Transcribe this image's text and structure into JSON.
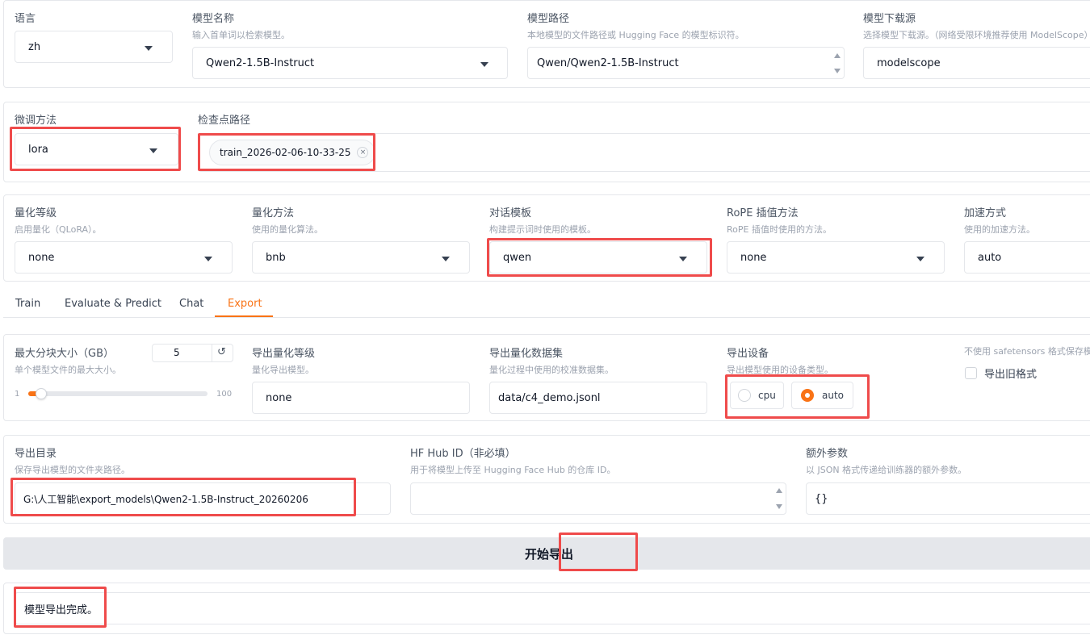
{
  "row1": {
    "language": {
      "label": "语言",
      "value": "zh"
    },
    "model_name": {
      "label": "模型名称",
      "hint": "输入首单词以检索模型。",
      "value": "Qwen2-1.5B-Instruct"
    },
    "model_path": {
      "label": "模型路径",
      "hint": "本地模型的文件路径或 Hugging Face 的模型标识符。",
      "value": "Qwen/Qwen2-1.5B-Instruct"
    },
    "download_source": {
      "label": "模型下载源",
      "hint": "选择模型下载源。（网络受限环境推荐使用 ModelScope）",
      "value": "modelscope"
    }
  },
  "row2": {
    "finetune": {
      "label": "微调方法",
      "value": "lora"
    },
    "checkpoint": {
      "label": "检查点路径",
      "tag": "train_2026-02-06-10-33-25"
    }
  },
  "row3": {
    "quant_bit": {
      "label": "量化等级",
      "hint": "启用量化（QLoRA）。",
      "value": "none"
    },
    "quant_method": {
      "label": "量化方法",
      "hint": "使用的量化算法。",
      "value": "bnb"
    },
    "template": {
      "label": "对话模板",
      "hint": "构建提示词时使用的模板。",
      "value": "qwen"
    },
    "rope": {
      "label": "RoPE 插值方法",
      "hint": "RoPE 插值时使用的方法。",
      "value": "none"
    },
    "booster": {
      "label": "加速方式",
      "hint": "使用的加速方法。",
      "value": "auto"
    }
  },
  "tabs": [
    "Train",
    "Evaluate & Predict",
    "Chat",
    "Export"
  ],
  "active_tab": "Export",
  "export": {
    "shard": {
      "label": "最大分块大小（GB）",
      "hint": "单个模型文件的最大大小。",
      "value": "5",
      "min": "1",
      "max": "100",
      "slider_fraction": 0.04
    },
    "quant_bit": {
      "label": "导出量化等级",
      "hint": "量化导出模型。",
      "value": "none"
    },
    "quant_dataset": {
      "label": "导出量化数据集",
      "hint": "量化过程中使用的校准数据集。",
      "value": "data/c4_demo.jsonl"
    },
    "device": {
      "label": "导出设备",
      "hint": "导出模型使用的设备类型。",
      "options": [
        "cpu",
        "auto"
      ],
      "selected": "auto"
    },
    "legacy": {
      "hint": "不使用 safetensors 格式保存模型。",
      "label": "导出旧格式"
    },
    "dir": {
      "label": "导出目录",
      "hint": "保存导出模型的文件夹路径。",
      "value": "G:\\人工智能\\export_models\\Qwen2-1.5B-Instruct_20260206"
    },
    "hub_id": {
      "label": "HF Hub ID（非必填）",
      "hint": "用于将模型上传至 Hugging Face Hub 的仓库 ID。",
      "value": ""
    },
    "extra": {
      "label": "额外参数",
      "hint": "以 JSON 格式传递给训练器的额外参数。",
      "value": "{}"
    },
    "start_button": "开始导出",
    "status": "模型导出完成。"
  },
  "colors": {
    "accent": "#f97316",
    "highlight": "#ef4b4b"
  }
}
